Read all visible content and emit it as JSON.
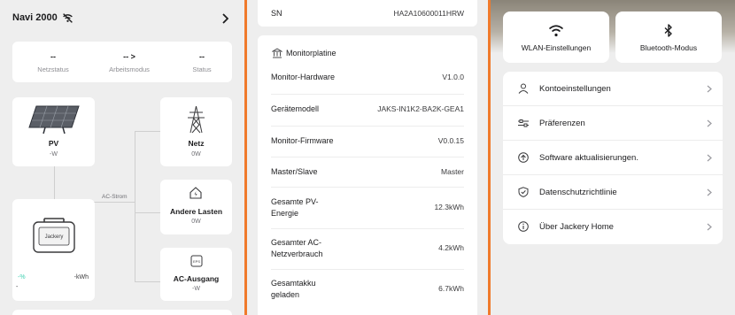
{
  "panel1": {
    "title": "Navi 2000",
    "stats": [
      {
        "value": "--",
        "label": "Netzstatus"
      },
      {
        "value": "-- >",
        "label": "Arbeitsmodus"
      },
      {
        "value": "--",
        "label": "Status"
      }
    ],
    "pv": {
      "name": "PV",
      "value": "-W"
    },
    "grid": {
      "name": "Netz",
      "value": "0W"
    },
    "other_loads": {
      "name": "Andere Lasten",
      "value": "0W"
    },
    "ac_output": {
      "name": "AC-Ausgang",
      "value": "-W"
    },
    "ac_line_label": "AC-Strom",
    "battery": {
      "percent": "-%",
      "energy": "-kWh",
      "extra": "-",
      "brand": "Jackery"
    }
  },
  "panel2": {
    "sn_label": "SN",
    "sn_value": "HA2A10600011HRW",
    "section_title": "Monitorplatine",
    "rows": [
      {
        "key": "Monitor-Hardware",
        "value": "V1.0.0"
      },
      {
        "key": "Gerätemodell",
        "value": "JAKS-IN1K2-BA2K-GEA1"
      },
      {
        "key": "Monitor-Firmware",
        "value": "V0.0.15"
      },
      {
        "key": "Master/Slave",
        "value": "Master"
      },
      {
        "key_line1": "Gesamte PV-",
        "key_line2": "Energie",
        "value": "12.3kWh"
      },
      {
        "key_line1": "Gesamter AC-",
        "key_line2": "Netzverbrauch",
        "value": "4.2kWh"
      },
      {
        "key_line1": "Gesamtakku",
        "key_line2": "geladen",
        "value": "6.7kWh"
      }
    ]
  },
  "panel3": {
    "wifi_label": "WLAN-Einstellungen",
    "bluetooth_label": "Bluetooth-Modus",
    "menu": [
      {
        "label": "Kontoeinstellungen",
        "icon": "person-icon"
      },
      {
        "label": "Präferenzen",
        "icon": "sliders-icon"
      },
      {
        "label": "Software aktualisierungen.",
        "icon": "update-icon"
      },
      {
        "label": "Datenschutzrichtlinie",
        "icon": "shield-icon"
      },
      {
        "label": "Über Jackery Home",
        "icon": "info-icon"
      }
    ]
  },
  "colors": {
    "divider": "#f07a2c",
    "accent_green": "#3fd0b0",
    "background": "#eeeeee"
  }
}
